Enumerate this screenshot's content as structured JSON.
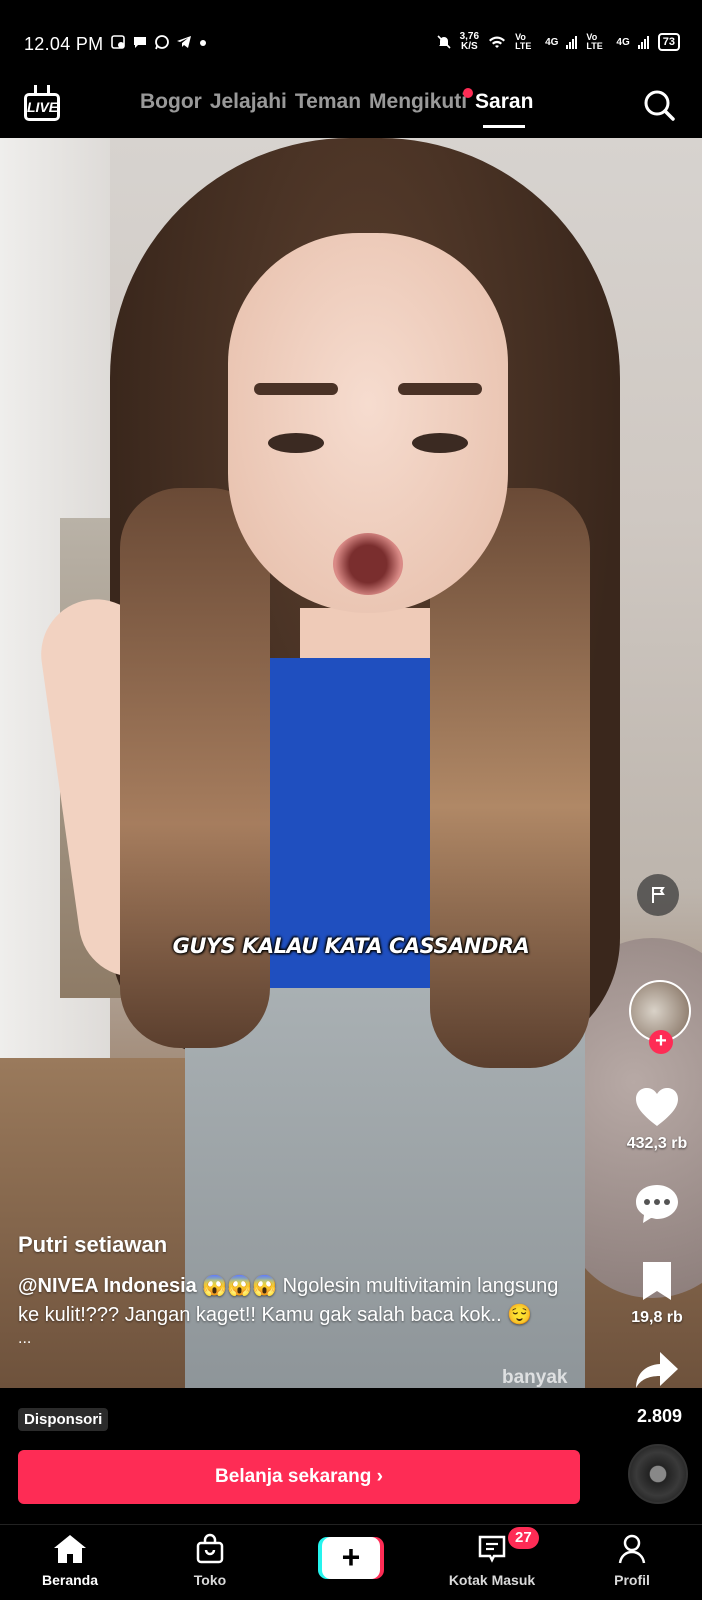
{
  "status_bar": {
    "time": "12.04 PM",
    "left_icons": [
      "sim-icon",
      "chat-bubble-icon",
      "whatsapp-icon",
      "telegram-icon",
      "dot-icon"
    ],
    "net_speed": "3,76",
    "net_speed_unit": "K/S",
    "sim1": "Vo LTE",
    "sim1_net": "4G",
    "sim2": "Vo LTE",
    "sim2_net": "4G",
    "battery": "73"
  },
  "top_nav": {
    "live_label": "LIVE",
    "tabs": [
      {
        "label": "Bogor"
      },
      {
        "label": "Jelajahi"
      },
      {
        "label": "Teman"
      },
      {
        "label": "Mengikuti"
      },
      {
        "label": "Saran"
      }
    ],
    "active_tab": "Saran"
  },
  "video": {
    "caption_overlay": "GUYS KALAU KATA CASSANDRA",
    "watermark": "banyak"
  },
  "right_rail": {
    "likes": "432,3 rb",
    "comments": "",
    "saves": "19,8 rb",
    "shares": "2.809"
  },
  "post": {
    "author": "Putri setiawan",
    "mention": "@NIVEA Indonesia",
    "emojis": "😱😱😱",
    "text": " Ngolesin multivitamin langsung ke kulit!??? Jangan kaget!! Kamu gak salah baca kok.. 😌",
    "more": "..."
  },
  "sponsored": {
    "badge": "Disponsori",
    "cta": "Belanja sekarang ›"
  },
  "bottom_nav": {
    "home": "Beranda",
    "shop": "Toko",
    "create": "+",
    "inbox": "Kotak Masuk",
    "inbox_badge": "27",
    "profile": "Profil"
  },
  "colors": {
    "accent": "#fe2c55",
    "cyan": "#25f4ee",
    "shirt": "#1f4fbf"
  }
}
